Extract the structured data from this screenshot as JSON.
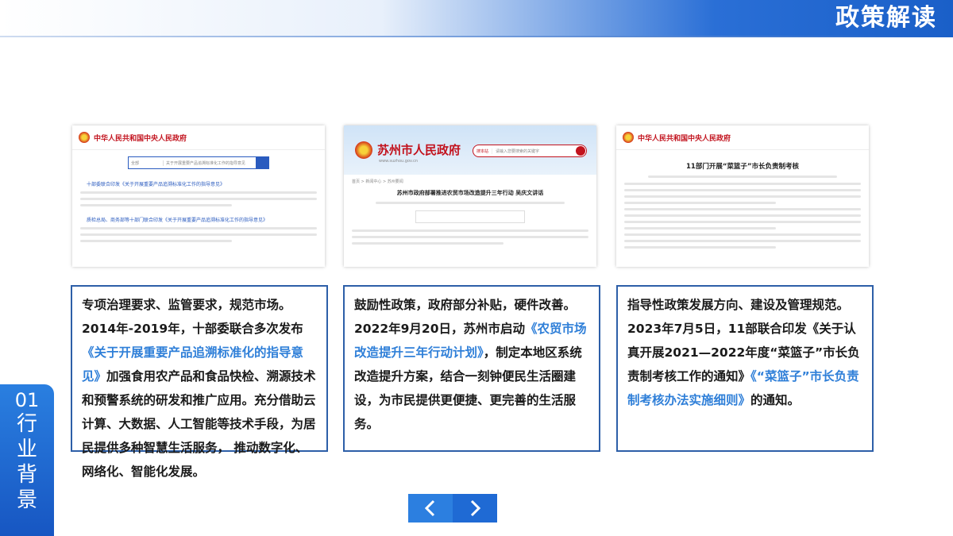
{
  "header": {
    "title": "政策解读"
  },
  "thumbnails": [
    {
      "site": "中华人民共和国中央人民政府",
      "domain": "www.gov.cn",
      "search_scope": "全部",
      "search_text": "关于开展重要产品追溯标准化工作的指导意见",
      "result1_title": "十部委联合印发《关于开展重要产品追溯标准化工作的指导意见》",
      "result2_title": "重要产品追溯体系建设",
      "result3_title": "质检总局、商务部等十部门联合印发《关于开展重要产品追溯标准化工作的指导意见》"
    },
    {
      "site": "苏州市人民政府",
      "domain": "www.suzhou.gov.cn",
      "search_placeholder": "请输入您要搜索的关键字",
      "search_label": "搜本站",
      "breadcrumb": "首页 > 新闻中心 > 苏州要闻",
      "article_title": "苏州市政府部署推进农贸市场改造提升三年行动 吴庆文讲话"
    },
    {
      "site": "中华人民共和国中央人民政府",
      "domain": "www.gov.cn",
      "article_title": "11部门开展“菜篮子”市长负责制考核"
    }
  ],
  "captions": [
    {
      "lead": "专项治理要求、监管要求，规范市场。",
      "text_before": "2014年-2019年，十部委联合多次发布",
      "highlight": "《关于开展重要产品追溯标准化的指导意见》",
      "text_after": "加强食用农产品和食品快检、溯源技术和预警系统的研发和推广应用。充分借助云计算、大数据、人工智能等技术手段，为居民提供多种智慧生活服务， 推动数字化、网络化、智能化发展。"
    },
    {
      "lead": "鼓励性政策，政府部分补贴，硬件改善。",
      "text_before": "2022年9月20日，苏州市启动",
      "highlight": "《农贸市场改造提升三年行动计划》",
      "text_after": "，制定本地区系统改造提升方案，结合一刻钟便民生活圈建设，为市民提供更便捷、更完善的生活服务。"
    },
    {
      "lead": "指导性政策发展方向、建设及管理规范。",
      "text_before": "2023年7月5日，11部联合印发《关于认真开展2021—2022年度“菜篮子”市长负责制考核工作的通知》",
      "highlight": "《“菜篮子”市长负责制考核办法实施细则》",
      "text_after": "的通知。"
    }
  ],
  "section": {
    "number": "01",
    "chars": [
      "行",
      "业",
      "背",
      "景"
    ]
  },
  "nav": {
    "prev": "‹",
    "next": "›"
  }
}
